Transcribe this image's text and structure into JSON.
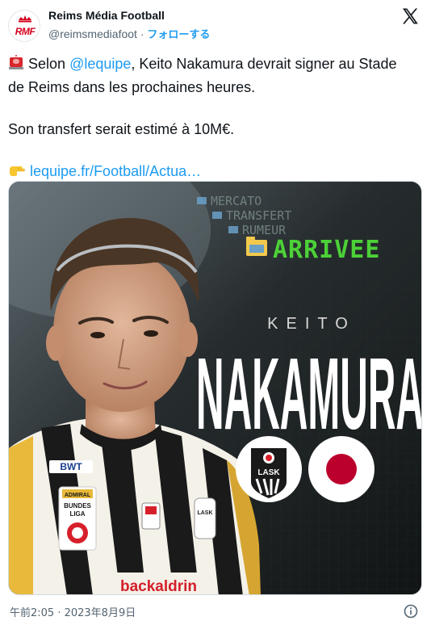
{
  "account": {
    "display_name": "Reims Média Football",
    "handle": "@reimsmediafoot",
    "separator": "·",
    "follow_label": "フォローする",
    "avatar_text": "RMF",
    "avatar_icon": "crown-icon"
  },
  "platform_icon": "x-logo-icon",
  "tweet": {
    "line1_emoji": "police-light-icon",
    "line1_before": "Selon ",
    "mention": "@lequipe",
    "line1_after": ", Keito Nakamura devrait signer au Stade de Reims dans les prochaines heures.",
    "line2": "Son transfert serait estimé à 10M€.",
    "link_emoji": "pointing-hand-icon",
    "link_text": "lequipe.fr/Football/Actua…"
  },
  "media": {
    "tags": [
      "MERCATO",
      "TRANSFERT",
      "RUMEUR"
    ],
    "status": "ARRIVEE",
    "first_name": "KEITO",
    "last_name": "NAKAMURA",
    "club_badge": "LASK",
    "shirt_sponsor": "BWT",
    "league_patch_top": "ADMIRAL",
    "league_patch_mid": "BUNDES",
    "league_patch_bottom": "LIGA",
    "chest_text": "backaldrin",
    "crest_text": "LASK",
    "colors": {
      "status_green": "#4cd137",
      "flag_red": "#bc002d",
      "mention_blue": "#1d9bf0"
    }
  },
  "footer": {
    "timestamp": "午前2:05 · 2023年8月9日",
    "info_icon": "info-icon"
  }
}
